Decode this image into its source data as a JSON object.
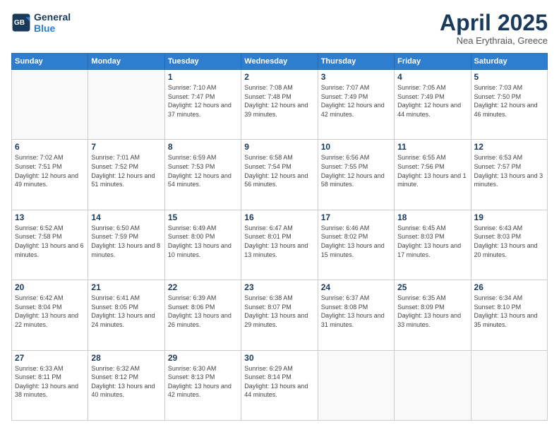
{
  "header": {
    "logo_line1": "General",
    "logo_line2": "Blue",
    "month": "April 2025",
    "location": "Nea Erythraia, Greece"
  },
  "weekdays": [
    "Sunday",
    "Monday",
    "Tuesday",
    "Wednesday",
    "Thursday",
    "Friday",
    "Saturday"
  ],
  "weeks": [
    [
      {
        "day": "",
        "info": ""
      },
      {
        "day": "",
        "info": ""
      },
      {
        "day": "1",
        "info": "Sunrise: 7:10 AM\nSunset: 7:47 PM\nDaylight: 12 hours and 37 minutes."
      },
      {
        "day": "2",
        "info": "Sunrise: 7:08 AM\nSunset: 7:48 PM\nDaylight: 12 hours and 39 minutes."
      },
      {
        "day": "3",
        "info": "Sunrise: 7:07 AM\nSunset: 7:49 PM\nDaylight: 12 hours and 42 minutes."
      },
      {
        "day": "4",
        "info": "Sunrise: 7:05 AM\nSunset: 7:49 PM\nDaylight: 12 hours and 44 minutes."
      },
      {
        "day": "5",
        "info": "Sunrise: 7:03 AM\nSunset: 7:50 PM\nDaylight: 12 hours and 46 minutes."
      }
    ],
    [
      {
        "day": "6",
        "info": "Sunrise: 7:02 AM\nSunset: 7:51 PM\nDaylight: 12 hours and 49 minutes."
      },
      {
        "day": "7",
        "info": "Sunrise: 7:01 AM\nSunset: 7:52 PM\nDaylight: 12 hours and 51 minutes."
      },
      {
        "day": "8",
        "info": "Sunrise: 6:59 AM\nSunset: 7:53 PM\nDaylight: 12 hours and 54 minutes."
      },
      {
        "day": "9",
        "info": "Sunrise: 6:58 AM\nSunset: 7:54 PM\nDaylight: 12 hours and 56 minutes."
      },
      {
        "day": "10",
        "info": "Sunrise: 6:56 AM\nSunset: 7:55 PM\nDaylight: 12 hours and 58 minutes."
      },
      {
        "day": "11",
        "info": "Sunrise: 6:55 AM\nSunset: 7:56 PM\nDaylight: 13 hours and 1 minute."
      },
      {
        "day": "12",
        "info": "Sunrise: 6:53 AM\nSunset: 7:57 PM\nDaylight: 13 hours and 3 minutes."
      }
    ],
    [
      {
        "day": "13",
        "info": "Sunrise: 6:52 AM\nSunset: 7:58 PM\nDaylight: 13 hours and 6 minutes."
      },
      {
        "day": "14",
        "info": "Sunrise: 6:50 AM\nSunset: 7:59 PM\nDaylight: 13 hours and 8 minutes."
      },
      {
        "day": "15",
        "info": "Sunrise: 6:49 AM\nSunset: 8:00 PM\nDaylight: 13 hours and 10 minutes."
      },
      {
        "day": "16",
        "info": "Sunrise: 6:47 AM\nSunset: 8:01 PM\nDaylight: 13 hours and 13 minutes."
      },
      {
        "day": "17",
        "info": "Sunrise: 6:46 AM\nSunset: 8:02 PM\nDaylight: 13 hours and 15 minutes."
      },
      {
        "day": "18",
        "info": "Sunrise: 6:45 AM\nSunset: 8:03 PM\nDaylight: 13 hours and 17 minutes."
      },
      {
        "day": "19",
        "info": "Sunrise: 6:43 AM\nSunset: 8:03 PM\nDaylight: 13 hours and 20 minutes."
      }
    ],
    [
      {
        "day": "20",
        "info": "Sunrise: 6:42 AM\nSunset: 8:04 PM\nDaylight: 13 hours and 22 minutes."
      },
      {
        "day": "21",
        "info": "Sunrise: 6:41 AM\nSunset: 8:05 PM\nDaylight: 13 hours and 24 minutes."
      },
      {
        "day": "22",
        "info": "Sunrise: 6:39 AM\nSunset: 8:06 PM\nDaylight: 13 hours and 26 minutes."
      },
      {
        "day": "23",
        "info": "Sunrise: 6:38 AM\nSunset: 8:07 PM\nDaylight: 13 hours and 29 minutes."
      },
      {
        "day": "24",
        "info": "Sunrise: 6:37 AM\nSunset: 8:08 PM\nDaylight: 13 hours and 31 minutes."
      },
      {
        "day": "25",
        "info": "Sunrise: 6:35 AM\nSunset: 8:09 PM\nDaylight: 13 hours and 33 minutes."
      },
      {
        "day": "26",
        "info": "Sunrise: 6:34 AM\nSunset: 8:10 PM\nDaylight: 13 hours and 35 minutes."
      }
    ],
    [
      {
        "day": "27",
        "info": "Sunrise: 6:33 AM\nSunset: 8:11 PM\nDaylight: 13 hours and 38 minutes."
      },
      {
        "day": "28",
        "info": "Sunrise: 6:32 AM\nSunset: 8:12 PM\nDaylight: 13 hours and 40 minutes."
      },
      {
        "day": "29",
        "info": "Sunrise: 6:30 AM\nSunset: 8:13 PM\nDaylight: 13 hours and 42 minutes."
      },
      {
        "day": "30",
        "info": "Sunrise: 6:29 AM\nSunset: 8:14 PM\nDaylight: 13 hours and 44 minutes."
      },
      {
        "day": "",
        "info": ""
      },
      {
        "day": "",
        "info": ""
      },
      {
        "day": "",
        "info": ""
      }
    ]
  ]
}
